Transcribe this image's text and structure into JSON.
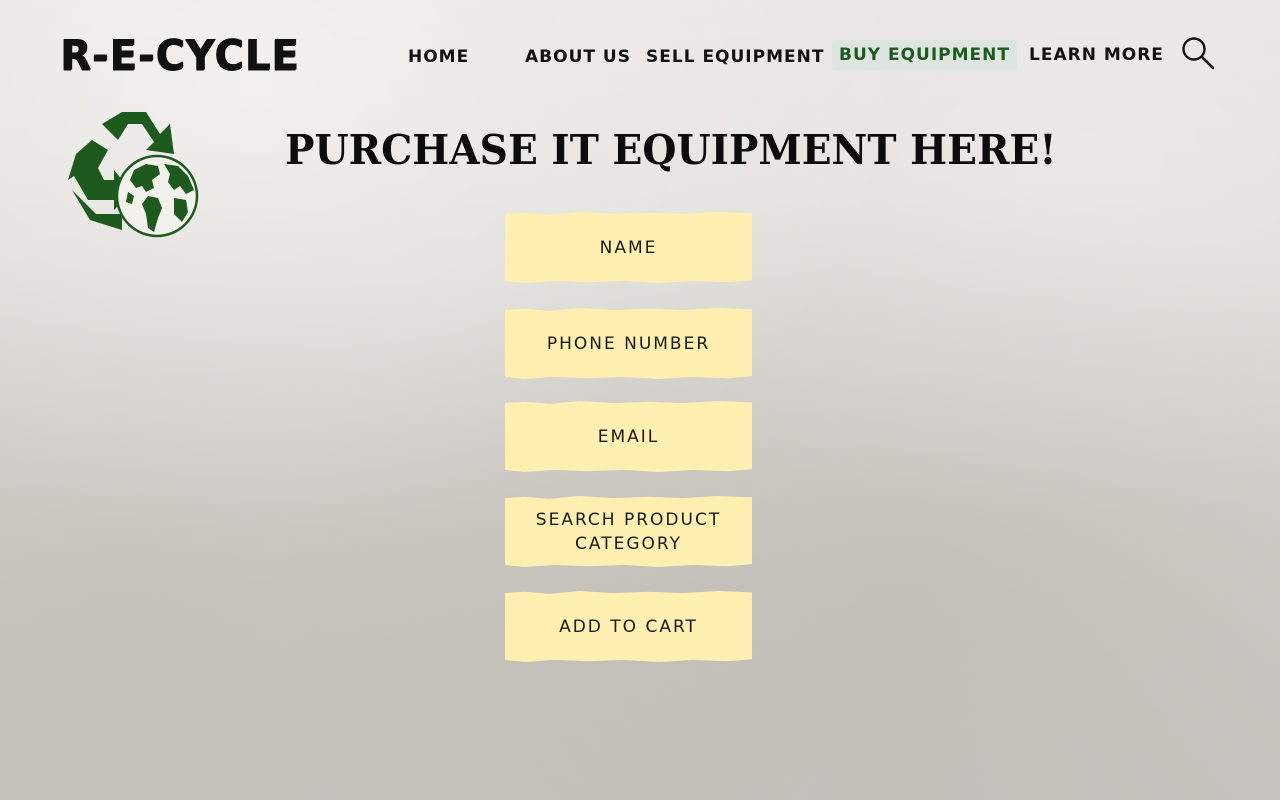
{
  "brand": {
    "logo_text": "R-E-CYCLE"
  },
  "nav": {
    "items": [
      {
        "label": "HOME",
        "active": false
      },
      {
        "label": "ABOUT US",
        "active": false
      },
      {
        "label": "SELL EQUIPMENT",
        "active": false
      },
      {
        "label": "BUY EQUIPMENT",
        "active": true
      },
      {
        "label": "LEARN MORE",
        "active": false
      }
    ],
    "search_icon": "search-icon"
  },
  "emblem": {
    "icon": "recycle-globe-icon"
  },
  "main": {
    "title": "PURCHASE IT EQUIPMENT HERE!",
    "fields": [
      {
        "label": "NAME"
      },
      {
        "label": "PHONE NUMBER"
      },
      {
        "label": "EMAIL"
      },
      {
        "label": "SEARCH PRODUCT CATEGORY"
      },
      {
        "label": "ADD TO CART"
      }
    ]
  },
  "colors": {
    "text": "#111111",
    "active_nav": "#1e5a1e",
    "field_bg": "#fff0b2",
    "emblem_green": "#1e5a1e"
  }
}
